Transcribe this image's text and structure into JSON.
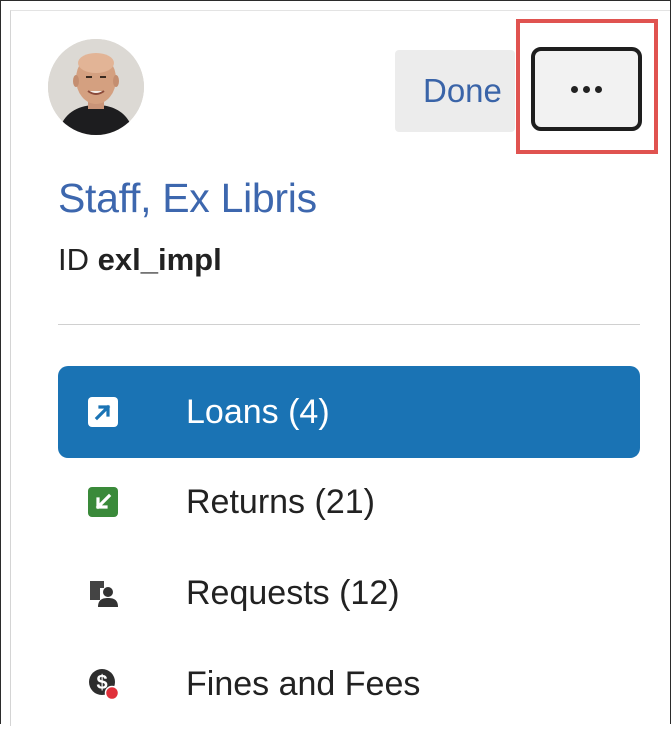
{
  "user": {
    "name": "Staff, Ex Libris",
    "id_label": "ID",
    "id_value": "exl_impl"
  },
  "header": {
    "done_label": "Done",
    "more_icon": "ellipsis-icon"
  },
  "nav": {
    "items": [
      {
        "label": "Loans (4)",
        "icon": "loan-arrow-icon",
        "active": true
      },
      {
        "label": "Returns (21)",
        "icon": "return-arrow-icon",
        "active": false
      },
      {
        "label": "Requests (12)",
        "icon": "requests-person-icon",
        "active": false
      },
      {
        "label": "Fines and Fees",
        "icon": "fines-dollar-icon",
        "active": false
      }
    ]
  },
  "colors": {
    "accent": "#1a73b4",
    "link": "#3d67ae",
    "returns_green": "#3a8a3a",
    "highlight_red": "#e05350",
    "notification_dot": "#e0303a"
  }
}
